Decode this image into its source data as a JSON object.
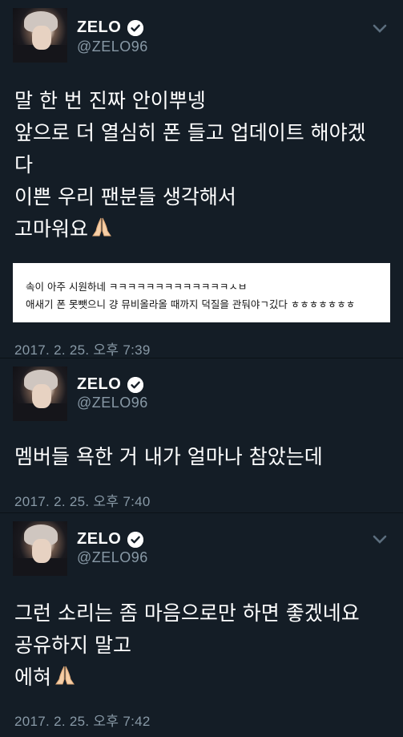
{
  "tweets": [
    {
      "name": "ZELO",
      "handle": "@ZELO96",
      "lines": [
        "말 한 번 진짜 안이뿌넹",
        "앞으로 더 열심히 폰 들고 업데이트 해야겠",
        "다",
        "이쁜 우리 팬분들 생각해서",
        "고마워요"
      ],
      "quote": [
        "속이 아주 시원하네 ㅋㅋㅋㅋㅋㅋㅋㅋㅋㅋㅋㅋㅋㅅㅂ",
        "애새기 폰 못뺏으니 걍 뮤비올라올 때까지 덕질을 관둬야ㄱ깄다 ㅎㅎㅎㅎㅎㅎㅎ"
      ],
      "time": "2017. 2. 25. 오후 7:39"
    },
    {
      "name": "ZELO",
      "handle": "@ZELO96",
      "lines": [
        "멤버들 욕한 거 내가 얼마나 참았는데"
      ],
      "time": "2017. 2. 25. 오후 7:40"
    },
    {
      "name": "ZELO",
      "handle": "@ZELO96",
      "lines": [
        "그런 소리는 좀 마음으로만 하면 좋겠네요",
        "공유하지 말고",
        "에혀"
      ],
      "time": "2017. 2. 25. 오후 7:42"
    }
  ],
  "icons": {
    "verified": "verified-badge-icon",
    "chevron": "chevron-down-icon",
    "emoji": "folded-hands-emoji-icon"
  },
  "colors": {
    "background": "#141d26",
    "secondary_text": "#8899a6",
    "primary_text": "#ffffff"
  }
}
